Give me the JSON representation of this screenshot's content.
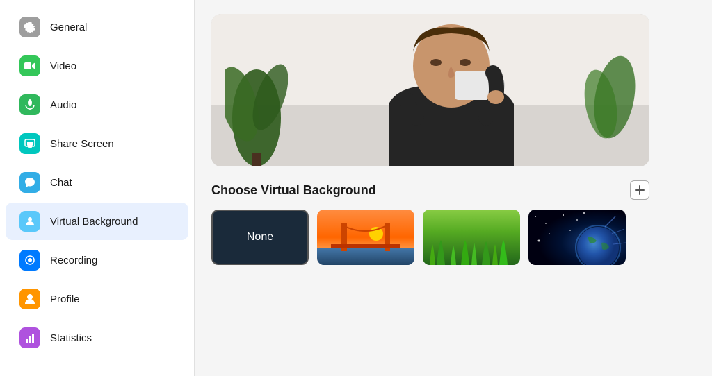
{
  "sidebar": {
    "items": [
      {
        "id": "general",
        "label": "General",
        "iconColor": "icon-gray",
        "iconSymbol": "⚙"
      },
      {
        "id": "video",
        "label": "Video",
        "iconColor": "icon-green",
        "iconSymbol": "▶"
      },
      {
        "id": "audio",
        "label": "Audio",
        "iconColor": "icon-green2",
        "iconSymbol": "🎧"
      },
      {
        "id": "share-screen",
        "label": "Share Screen",
        "iconColor": "icon-teal",
        "iconSymbol": "⬛"
      },
      {
        "id": "chat",
        "label": "Chat",
        "iconColor": "icon-blue",
        "iconSymbol": "💬"
      },
      {
        "id": "virtual-background",
        "label": "Virtual Background",
        "iconColor": "icon-cyan",
        "iconSymbol": "👤",
        "active": true
      },
      {
        "id": "recording",
        "label": "Recording",
        "iconColor": "icon-blue2",
        "iconSymbol": "⏺"
      },
      {
        "id": "profile",
        "label": "Profile",
        "iconColor": "icon-orange",
        "iconSymbol": "👤"
      },
      {
        "id": "statistics",
        "label": "Statistics",
        "iconColor": "icon-purple",
        "iconSymbol": "📊"
      }
    ]
  },
  "main": {
    "choose_title": "Choose Virtual Background",
    "add_button_label": "+",
    "backgrounds": [
      {
        "id": "none",
        "label": "None",
        "type": "none"
      },
      {
        "id": "bridge",
        "label": "Golden Gate Bridge",
        "type": "bridge"
      },
      {
        "id": "grass",
        "label": "Grass field",
        "type": "grass"
      },
      {
        "id": "space",
        "label": "Space Earth",
        "type": "space"
      }
    ]
  }
}
